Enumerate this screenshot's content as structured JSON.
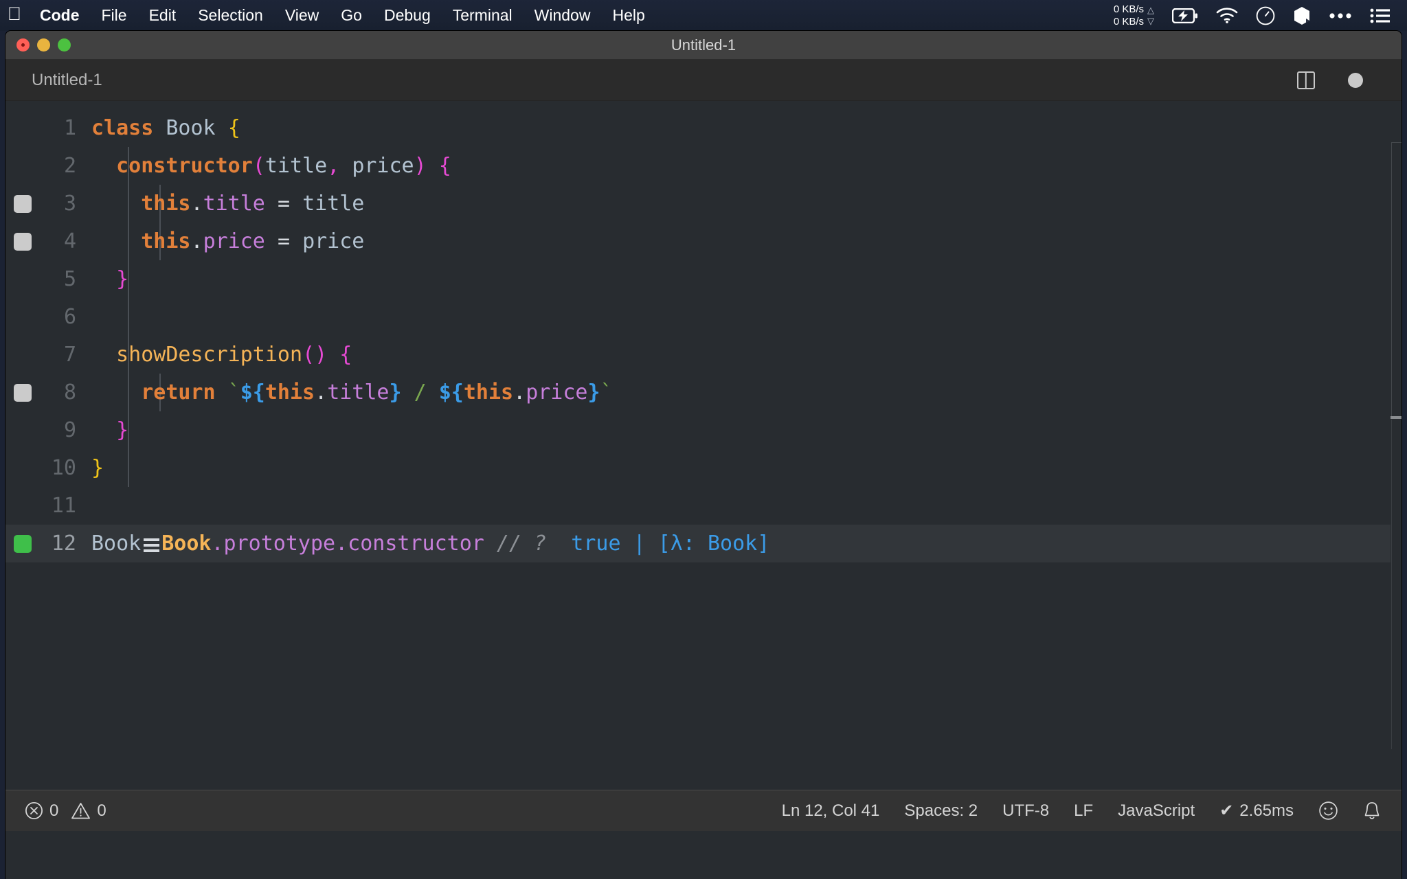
{
  "menubar": {
    "apple_icon": "apple-logo-icon",
    "items": [
      {
        "label": "Code",
        "bold": true
      },
      {
        "label": "File",
        "bold": false
      },
      {
        "label": "Edit",
        "bold": false
      },
      {
        "label": "Selection",
        "bold": false
      },
      {
        "label": "View",
        "bold": false
      },
      {
        "label": "Go",
        "bold": false
      },
      {
        "label": "Debug",
        "bold": false
      },
      {
        "label": "Terminal",
        "bold": false
      },
      {
        "label": "Window",
        "bold": false
      },
      {
        "label": "Help",
        "bold": false
      }
    ],
    "tray": {
      "net_up": "0 KB/s",
      "net_down": "0 KB/s",
      "icons": [
        "battery-charging-icon",
        "wifi-icon",
        "clock-icon",
        "dropbox-icon",
        "ellipsis-icon",
        "control-center-icon"
      ]
    }
  },
  "window": {
    "title": "Untitled-1",
    "traffic_lights": [
      "close-button",
      "minimize-button",
      "maximize-button"
    ]
  },
  "tabs": {
    "active": "Untitled-1",
    "actions": [
      "split-editor-icon",
      "unsaved-indicator"
    ]
  },
  "editor": {
    "language": "JavaScript",
    "lines": [
      {
        "num": "1",
        "marker": "none",
        "active": false
      },
      {
        "num": "2",
        "marker": "none",
        "active": false
      },
      {
        "num": "3",
        "marker": "grey",
        "active": false
      },
      {
        "num": "4",
        "marker": "grey",
        "active": false
      },
      {
        "num": "5",
        "marker": "none",
        "active": false
      },
      {
        "num": "6",
        "marker": "none",
        "active": false
      },
      {
        "num": "7",
        "marker": "none",
        "active": false
      },
      {
        "num": "8",
        "marker": "grey",
        "active": false
      },
      {
        "num": "9",
        "marker": "none",
        "active": false
      },
      {
        "num": "10",
        "marker": "none",
        "active": false
      },
      {
        "num": "11",
        "marker": "none",
        "active": false
      },
      {
        "num": "12",
        "marker": "green",
        "active": true
      }
    ],
    "source_text": [
      "class Book {",
      "  constructor(title, price) {",
      "    this.title = title",
      "    this.price = price",
      "  }",
      "",
      "  showDescription() {",
      "    return `${this.title} / ${this.price}`",
      "  }",
      "}",
      "",
      "Book === Book.prototype.constructor // ?  true | [λ: Book]"
    ],
    "line12": {
      "identifier": "Book",
      "operator": "===",
      "expression_object": "Book",
      "expression_props": ".prototype.constructor",
      "comment": "// ?",
      "result_value": "true",
      "result_separator": "|",
      "result_type": "[λ: Book]"
    }
  },
  "statusbar": {
    "errors_icon": "error-circle-icon",
    "errors": "0",
    "warnings_icon": "warning-triangle-icon",
    "warnings": "0",
    "cursor": "Ln 12, Col 41",
    "indent": "Spaces: 2",
    "encoding": "UTF-8",
    "eol": "LF",
    "language": "JavaScript",
    "runtime_check": "✔",
    "runtime": "2.65ms",
    "feedback_icon": "smiley-icon",
    "bell_icon": "bell-icon"
  },
  "colors": {
    "menubar_bg": "#1d2538",
    "titlebar_bg": "#414141",
    "tabbar_bg": "#2b2b2b",
    "editor_bg": "#282c30",
    "active_line_bg": "#32363a",
    "statusbar_bg": "#333333",
    "keyword": "#e2803a",
    "class_name": "#b3c3d1",
    "property": "#c77fdb",
    "brace_yellow": "#f0c419",
    "brace_pink": "#e64ad3",
    "function": "#f5b457",
    "template": "#3b9ce8",
    "comment": "#8d9196",
    "marker_grey": "#cbcbcb",
    "marker_green": "#3fbf4a"
  }
}
